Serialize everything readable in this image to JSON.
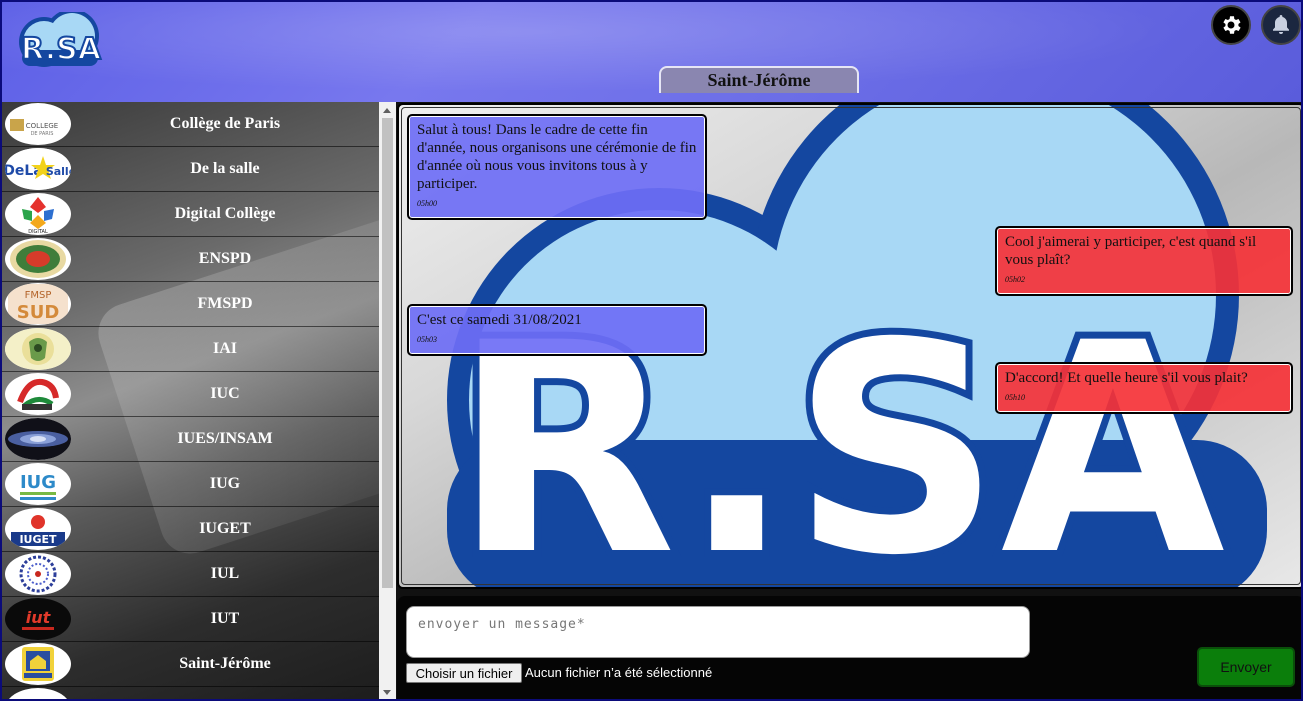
{
  "header": {
    "logo_text": "R.SA",
    "settings_icon": "gear-icon",
    "notifications_icon": "bell-icon",
    "active_tab": "Saint-Jérôme"
  },
  "sidebar": {
    "items": [
      {
        "label": "Collège de Paris"
      },
      {
        "label": "De la salle"
      },
      {
        "label": "Digital Collège"
      },
      {
        "label": "ENSPD"
      },
      {
        "label": "FMSPD"
      },
      {
        "label": "IAI"
      },
      {
        "label": "IUC"
      },
      {
        "label": "IUES/INSAM"
      },
      {
        "label": "IUG"
      },
      {
        "label": "IUGET"
      },
      {
        "label": "IUL"
      },
      {
        "label": "IUT"
      },
      {
        "label": "Saint-Jérôme"
      },
      {
        "label": ""
      }
    ]
  },
  "chat": {
    "background_logo": "R.SA",
    "messages": [
      {
        "direction": "in",
        "text": "Salut à tous! Dans le cadre de cette fin d'année, nous organisons une cérémonie de fin d'année où nous vous invitons tous à y participer.",
        "time": "05h00"
      },
      {
        "direction": "out",
        "text": "Cool j'aimerai y participer, c'est quand s'il vous plaît?",
        "time": "05h02"
      },
      {
        "direction": "in",
        "text": "C'est ce samedi 31/08/2021",
        "time": "05h03"
      },
      {
        "direction": "out",
        "text": "D'accord! Et quelle heure s'il vous plait?",
        "time": "05h10"
      }
    ]
  },
  "composer": {
    "placeholder": "envoyer un message*",
    "file_button": "Choisir un fichier",
    "file_status": "Aucun fichier n’a été sélectionné",
    "send_label": "Envoyer"
  },
  "colors": {
    "header": "#6c6ee9",
    "incoming": "#6e6ef5",
    "outgoing": "#f53237",
    "send": "#0b7e0b",
    "logo_blue": "#1447a0",
    "logo_light": "#a8d8f5"
  }
}
